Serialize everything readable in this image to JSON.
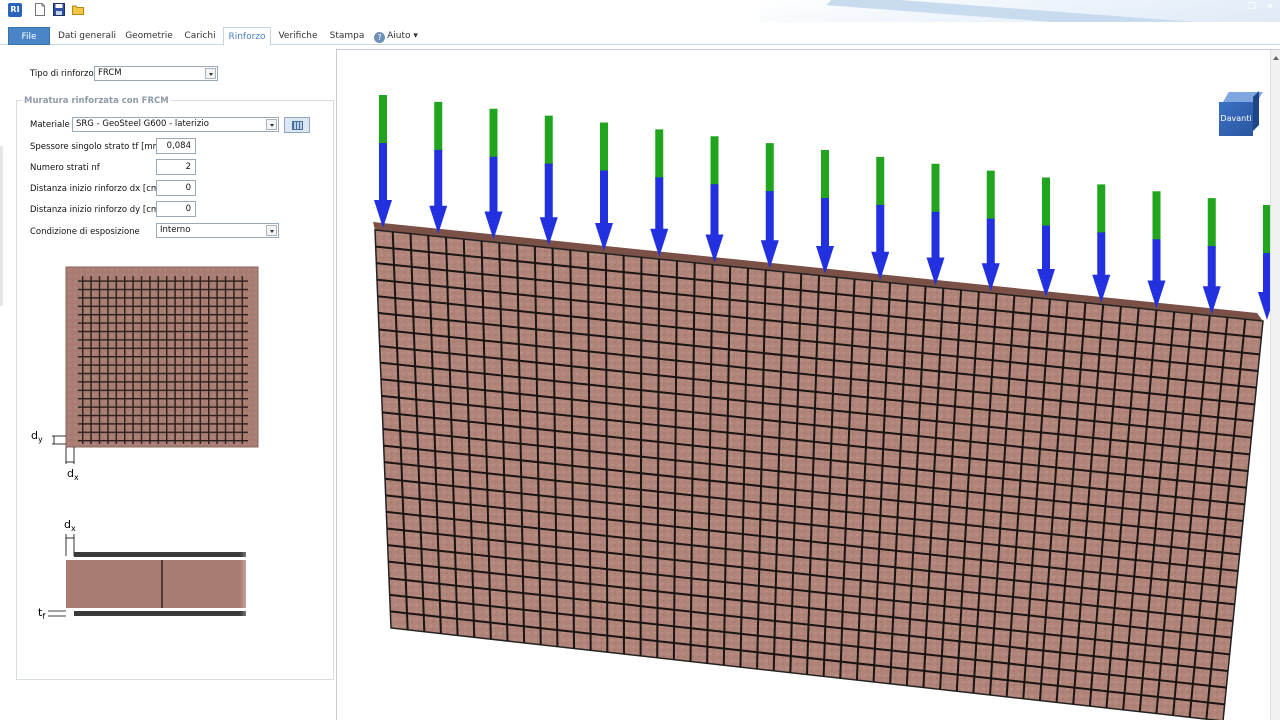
{
  "app": {
    "logo_text": "RI"
  },
  "tabs": [
    {
      "label": "File"
    },
    {
      "label": "Dati generali"
    },
    {
      "label": "Geometrie"
    },
    {
      "label": "Carichi"
    },
    {
      "label": "Rinforzo"
    },
    {
      "label": "Verifiche"
    },
    {
      "label": "Stampa"
    },
    {
      "label": "Aiuto"
    }
  ],
  "form": {
    "tipo_label": "Tipo di rinforzo",
    "tipo_value": "FRCM",
    "group_title": "Muratura rinforzata con FRCM",
    "materiale_label": "Materiale",
    "materiale_value": "SRG - GeoSteel G600 - laterizio",
    "spessore_label": "Spessore singolo strato tf [mm]",
    "spessore_value": "0,084",
    "strati_label": "Numero strati nf",
    "strati_value": "2",
    "dx_label": "Distanza inizio rinforzo dx [cm]",
    "dx_value": "0",
    "dy_label": "Distanza inizio rinforzo dy [cm]",
    "dy_value": "0",
    "esposizione_label": "Condizione di esposizione",
    "esposizione_value": "Interno"
  },
  "diagram": {
    "dy_main": "d",
    "dy_sub": "y",
    "dx_main": "d",
    "dx_sub": "x",
    "tf_main": "t",
    "tf_sub": "f"
  },
  "viewport": {
    "cube_label": "Davanti"
  },
  "colors": {
    "accent": "#4a86c7",
    "masonry": "#a97d74",
    "arrow_shaft": "#2230e0",
    "arrow_tail": "#22a51e"
  },
  "icons": [
    "new-document-icon",
    "save-icon",
    "open-folder-icon",
    "help-icon",
    "restore-window-icon",
    "close-window-icon",
    "library-icon"
  ]
}
